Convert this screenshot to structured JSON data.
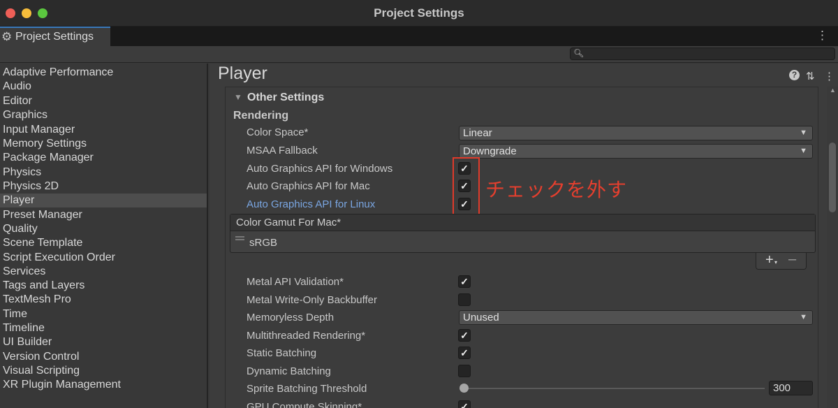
{
  "window": {
    "title": "Project Settings"
  },
  "tab": {
    "label": "Project Settings",
    "gear_icon": "gear-icon"
  },
  "search": {
    "placeholder": ""
  },
  "sidebar": {
    "items": [
      "Adaptive Performance",
      "Audio",
      "Editor",
      "Graphics",
      "Input Manager",
      "Memory Settings",
      "Package Manager",
      "Physics",
      "Physics 2D",
      "Player",
      "Preset Manager",
      "Quality",
      "Scene Template",
      "Script Execution Order",
      "Services",
      "Tags and Layers",
      "TextMesh Pro",
      "Time",
      "Timeline",
      "UI Builder",
      "Version Control",
      "Visual Scripting",
      "XR Plugin Management"
    ],
    "active": "Player"
  },
  "main": {
    "title": "Player",
    "section": {
      "title": "Other Settings",
      "subhead": "Rendering",
      "color_space": {
        "label": "Color Space*",
        "value": "Linear"
      },
      "msaa_fallback": {
        "label": "MSAA Fallback",
        "value": "Downgrade"
      },
      "auto_api_windows": {
        "label": "Auto Graphics API  for Windows",
        "checked": true
      },
      "auto_api_mac": {
        "label": "Auto Graphics API  for Mac",
        "checked": true
      },
      "auto_api_linux": {
        "label": "Auto Graphics API  for Linux",
        "checked": true
      },
      "color_gamut": {
        "header": "Color Gamut For Mac*",
        "items": [
          "sRGB"
        ]
      },
      "metal_api_validation": {
        "label": "Metal API Validation*",
        "checked": true
      },
      "metal_write_only": {
        "label": "Metal Write-Only Backbuffer",
        "checked": false
      },
      "memoryless_depth": {
        "label": "Memoryless Depth",
        "value": "Unused"
      },
      "multithreaded_rendering": {
        "label": "Multithreaded Rendering*",
        "checked": true
      },
      "static_batching": {
        "label": "Static Batching",
        "checked": true
      },
      "dynamic_batching": {
        "label": "Dynamic Batching",
        "checked": false
      },
      "sprite_batching": {
        "label": "Sprite Batching Threshold",
        "value": "300",
        "slider_fraction": 0.0
      },
      "gpu_skinning": {
        "label": "GPU Compute Skinning*",
        "checked": true
      }
    },
    "annotation": "チェックを外す"
  },
  "colors": {
    "annotation": "#e53f2e",
    "link": "#7aa6e2",
    "tab_accent": "#3a79bb"
  }
}
